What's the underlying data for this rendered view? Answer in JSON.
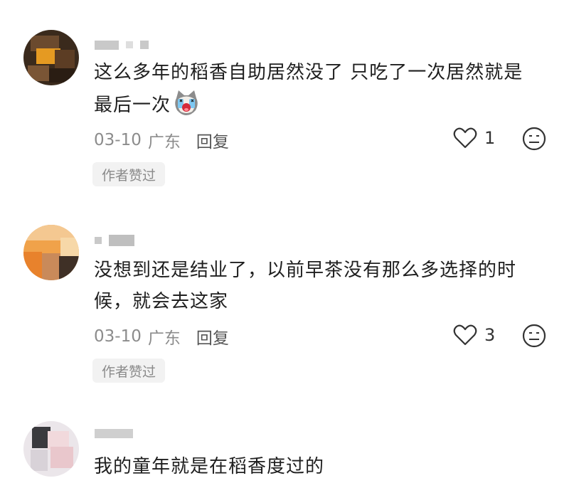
{
  "comments": [
    {
      "text_line1": "这么多年的稻香自助居然没了 只吃了一次居然就是",
      "text_line2": "最后一次",
      "emoji": "crying-cat-emoji",
      "date": "03-10",
      "location": "广东",
      "reply_label": "回复",
      "likes": "1",
      "badge": "作者赞过"
    },
    {
      "text_line1": "没想到还是结业了，以前早茶没有那么多选择的时",
      "text_line2": "候，就会去这家",
      "date": "03-10",
      "location": "广东",
      "reply_label": "回复",
      "likes": "3",
      "badge": "作者赞过"
    },
    {
      "text_line1": "我的童年就是在稻香度过的"
    }
  ],
  "icons": {
    "like": "heart-icon",
    "react": "emoji-face-icon"
  },
  "colors": {
    "text": "#1f1f1f",
    "meta": "#8c8c8c",
    "badge_bg": "#f2f2f2"
  }
}
